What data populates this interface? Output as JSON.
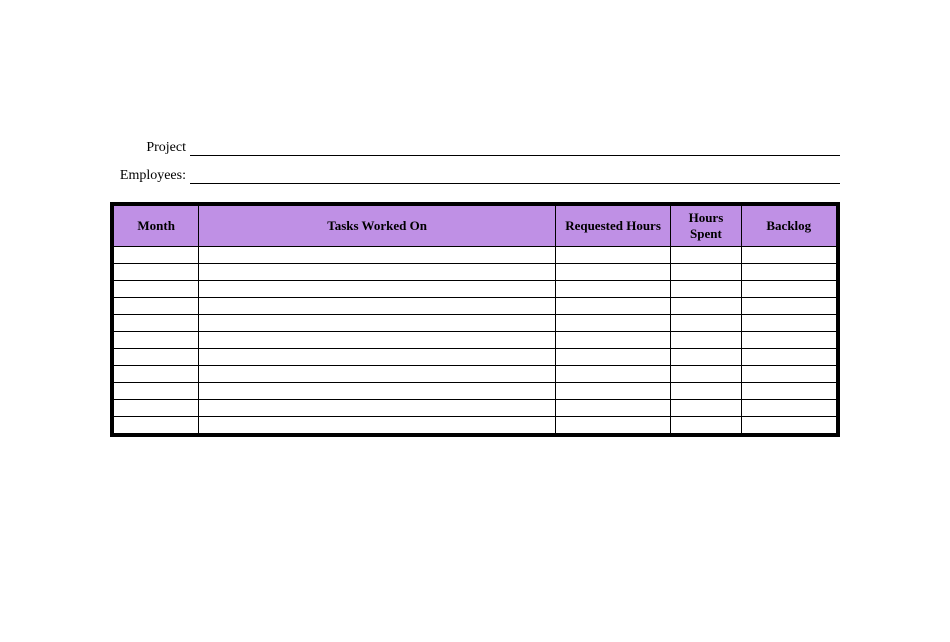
{
  "fields": {
    "project_label": "Project",
    "project_value": "",
    "employees_label": "Employees:",
    "employees_value": ""
  },
  "table": {
    "headers": {
      "month": "Month",
      "tasks": "Tasks Worked On",
      "requested": "Requested Hours",
      "hours_spent": "Hours Spent",
      "backlog": "Backlog"
    },
    "rows": [
      {
        "month": "",
        "tasks": "",
        "requested": "",
        "hours_spent": "",
        "backlog": ""
      },
      {
        "month": "",
        "tasks": "",
        "requested": "",
        "hours_spent": "",
        "backlog": ""
      },
      {
        "month": "",
        "tasks": "",
        "requested": "",
        "hours_spent": "",
        "backlog": ""
      },
      {
        "month": "",
        "tasks": "",
        "requested": "",
        "hours_spent": "",
        "backlog": ""
      },
      {
        "month": "",
        "tasks": "",
        "requested": "",
        "hours_spent": "",
        "backlog": ""
      },
      {
        "month": "",
        "tasks": "",
        "requested": "",
        "hours_spent": "",
        "backlog": ""
      },
      {
        "month": "",
        "tasks": "",
        "requested": "",
        "hours_spent": "",
        "backlog": ""
      },
      {
        "month": "",
        "tasks": "",
        "requested": "",
        "hours_spent": "",
        "backlog": ""
      },
      {
        "month": "",
        "tasks": "",
        "requested": "",
        "hours_spent": "",
        "backlog": ""
      },
      {
        "month": "",
        "tasks": "",
        "requested": "",
        "hours_spent": "",
        "backlog": ""
      },
      {
        "month": "",
        "tasks": "",
        "requested": "",
        "hours_spent": "",
        "backlog": ""
      }
    ]
  },
  "colors": {
    "header_bg": "#bf90e5"
  }
}
